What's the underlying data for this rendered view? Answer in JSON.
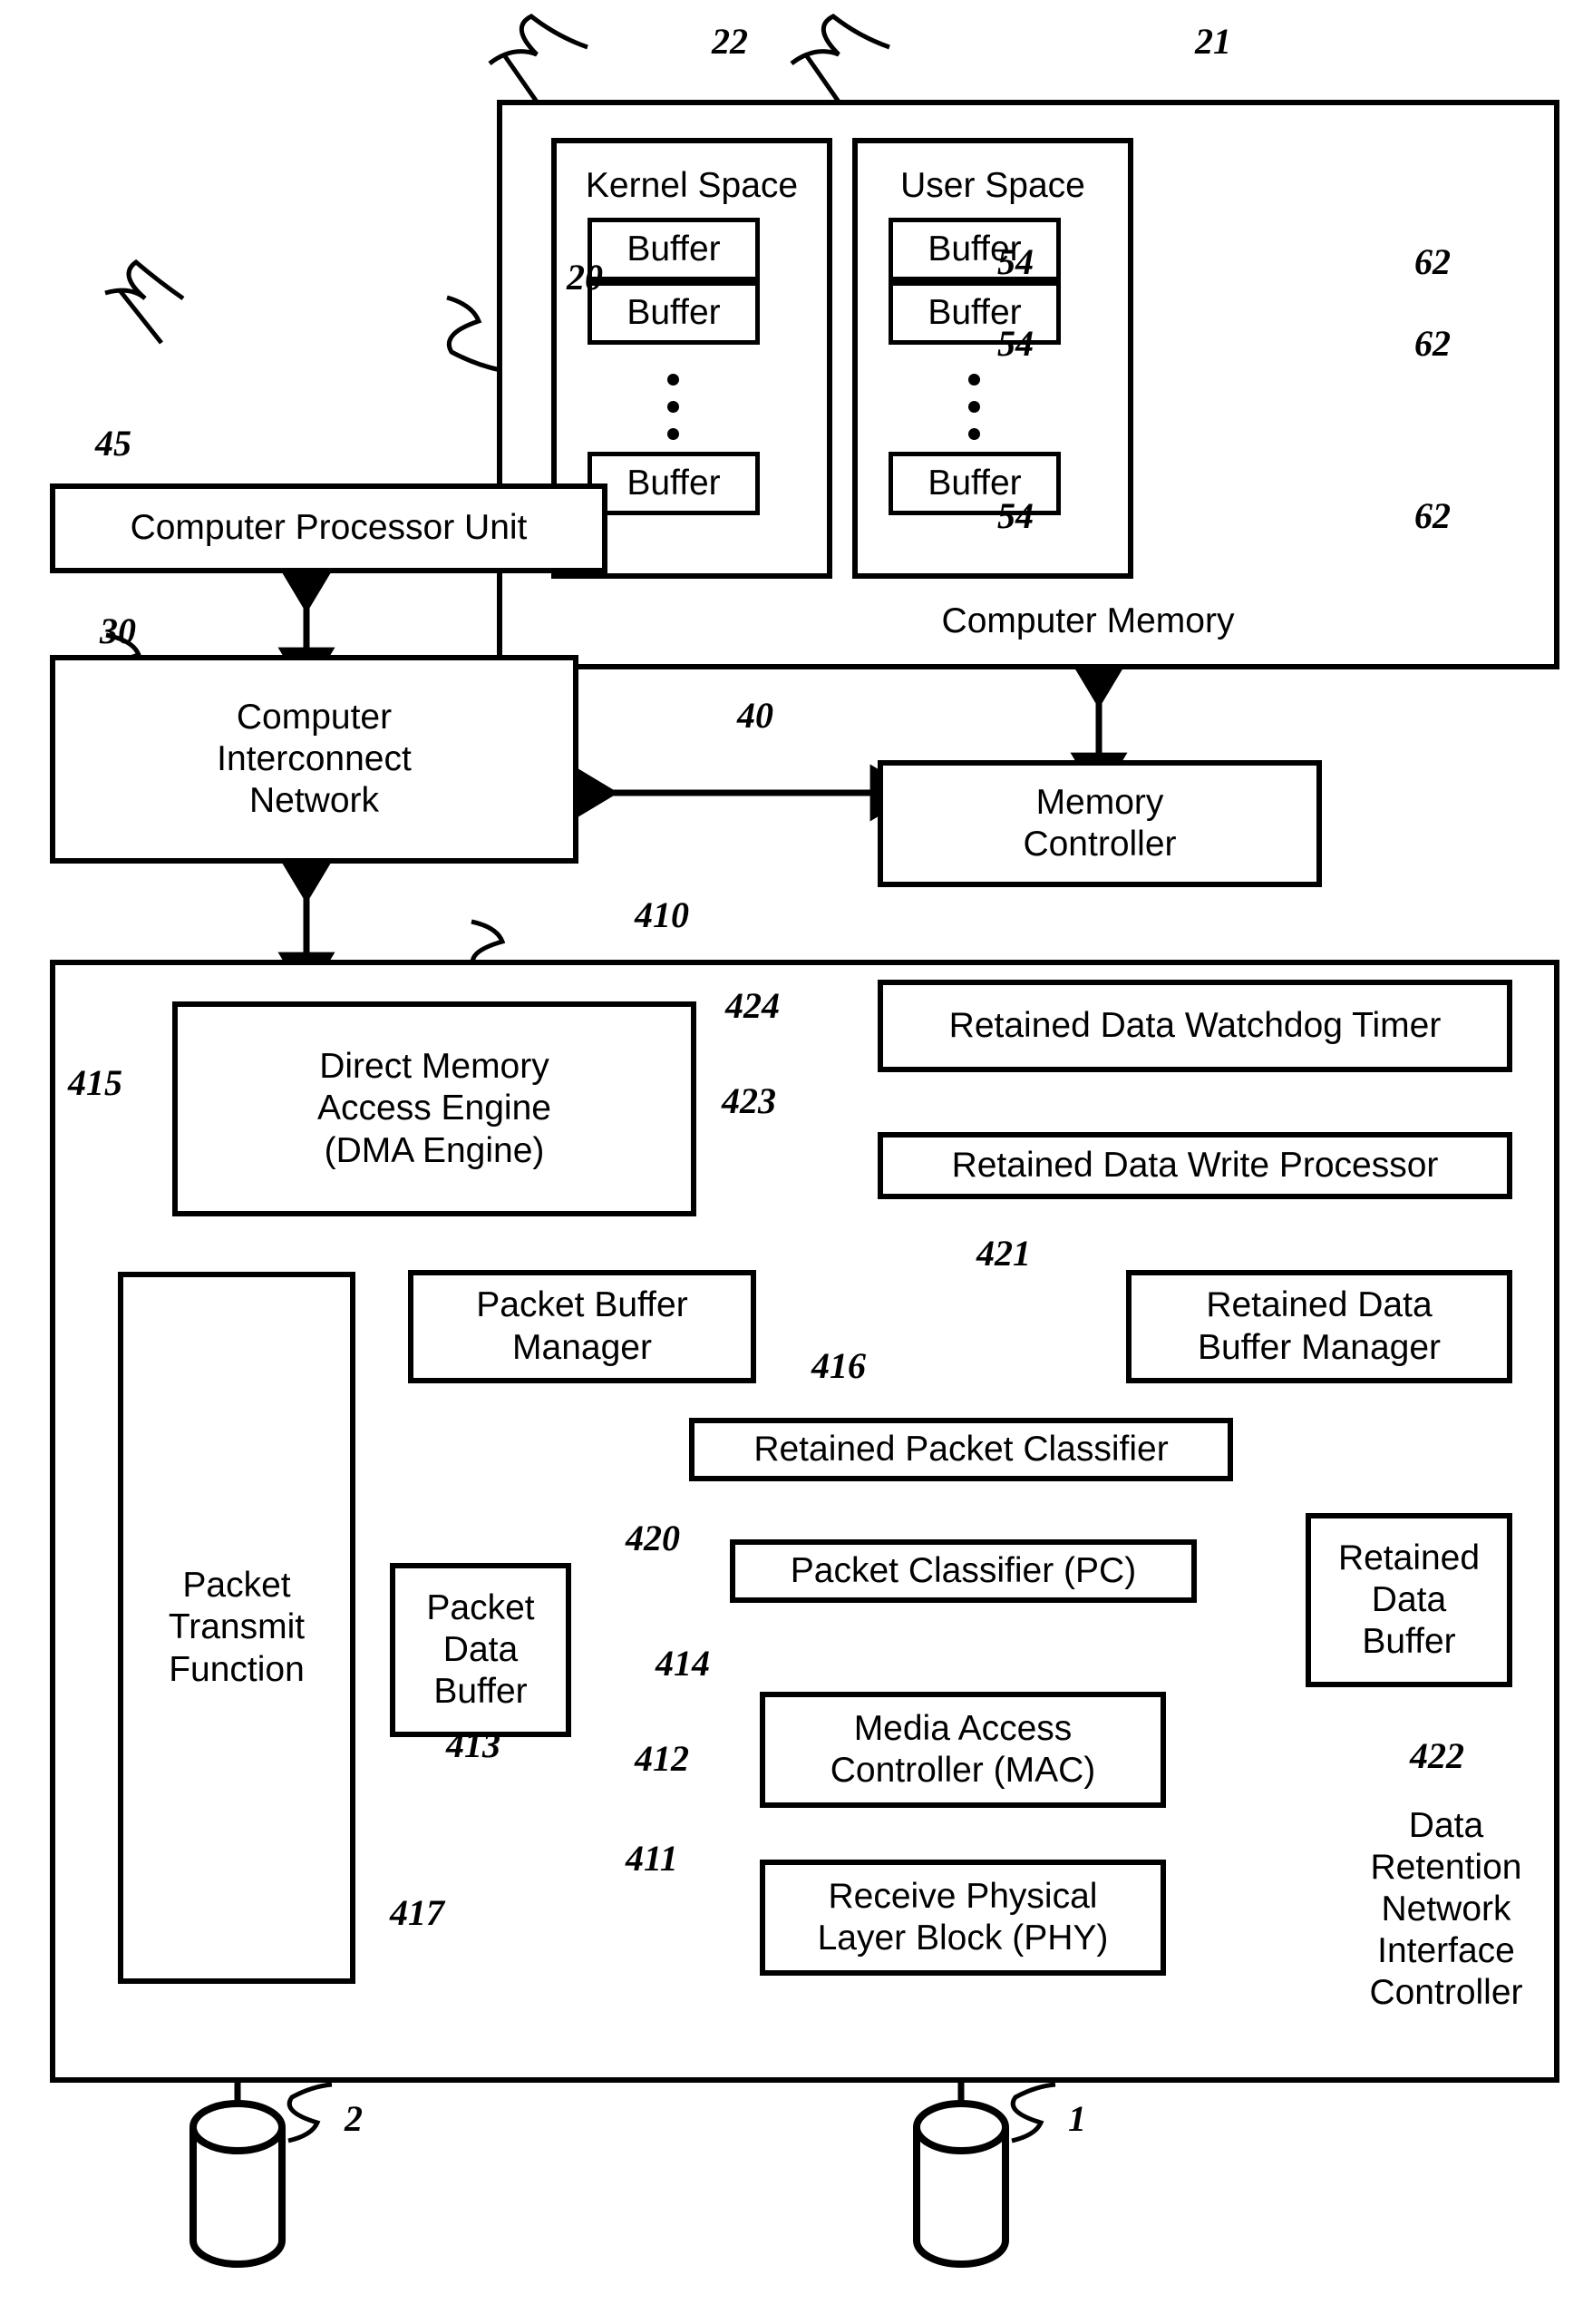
{
  "figure": {
    "title": "Data Retention Network Interface Controller block diagram"
  },
  "memory_system": {
    "outer_label": "Computer Memory",
    "outer_ref": "20",
    "kernel_space": {
      "title": "Kernel Space",
      "ref": "22",
      "buffers": [
        {
          "label": "Buffer",
          "ref": "54"
        },
        {
          "label": "Buffer",
          "ref": "54"
        },
        {
          "label": "Buffer",
          "ref": "54"
        }
      ]
    },
    "user_space": {
      "title": "User Space",
      "ref": "21",
      "buffers": [
        {
          "label": "Buffer",
          "ref": "62"
        },
        {
          "label": "Buffer",
          "ref": "62"
        },
        {
          "label": "Buffer",
          "ref": "62"
        }
      ]
    }
  },
  "host": {
    "cpu": {
      "label": "Computer Processor Unit",
      "ref": "45"
    },
    "interconnect": {
      "label": "Computer\nInterconnect\nNetwork",
      "ref": "30"
    },
    "memory_controller": {
      "label": "Memory\nController",
      "ref": "40"
    }
  },
  "nic": {
    "ref": "410",
    "caption": "Data\nRetention\nNetwork\nInterface\nController",
    "blocks": {
      "dma": {
        "label": "Direct Memory\nAccess Engine\n(DMA Engine)",
        "ref": "415"
      },
      "watchdog": {
        "label": "Retained Data Watchdog Timer",
        "ref": "424"
      },
      "write_processor": {
        "label": "Retained Data Write Processor",
        "ref": "423"
      },
      "packet_buffer_manager": {
        "label": "Packet Buffer\nManager",
        "ref": "416"
      },
      "retained_buffer_manager": {
        "label": "Retained Data\nBuffer Manager",
        "ref": "421"
      },
      "retained_packet_classifier": {
        "label": "Retained Packet Classifier",
        "ref": "420"
      },
      "packet_classifier": {
        "label": "Packet Classifier (PC)",
        "ref": "414"
      },
      "mac": {
        "label": "Media Access\nController (MAC)",
        "ref": "412"
      },
      "phy": {
        "label": "Receive Physical\nLayer Block (PHY)",
        "ref": "411"
      },
      "packet_transmit": {
        "label": "Packet\nTransmit\nFunction",
        "ref": "417"
      },
      "packet_data_buffer": {
        "label": "Packet\nData\nBuffer",
        "ref": "413"
      },
      "retained_data_buffer": {
        "label": "Retained\nData\nBuffer",
        "ref": "422"
      }
    }
  },
  "ports": {
    "transmit_port": {
      "ref": "2"
    },
    "receive_port": {
      "ref": "1"
    }
  },
  "colors": {
    "line": "#000000",
    "background": "#ffffff"
  }
}
